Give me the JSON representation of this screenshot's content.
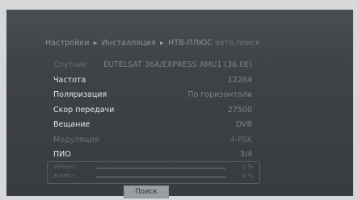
{
  "breadcrumb": {
    "items": [
      "Настройки",
      "Инсталляция",
      "НТВ-ПЛЮС",
      "авто поиск"
    ],
    "separator": "▸"
  },
  "satellite": {
    "label": "Спутник",
    "value": "EUTELSAT 36A/EXPRESS AMU1 (36.0E)"
  },
  "params": {
    "frequency": {
      "label": "Частота",
      "value": "12264"
    },
    "polarization": {
      "label": "Поляризация",
      "value": "По горизонтали"
    },
    "symbol_rate": {
      "label": "Скор передачи",
      "value": "27500"
    },
    "broadcast": {
      "label": "Вещание",
      "value": "DVB"
    },
    "modulation": {
      "label": "Модуляция",
      "value": "4-PSK"
    },
    "pid": {
      "label": "ПИО",
      "value": "3/4"
    }
  },
  "signal": {
    "strength": {
      "label": "Интенс",
      "value": "0 %",
      "level": 0
    },
    "quality": {
      "label": "Качест",
      "value": "0 %",
      "level": 0
    }
  },
  "search_button": {
    "label": "Поиск"
  },
  "colors": {
    "screen_bg": "#3f4246",
    "button_bg": "#9a9da1"
  }
}
